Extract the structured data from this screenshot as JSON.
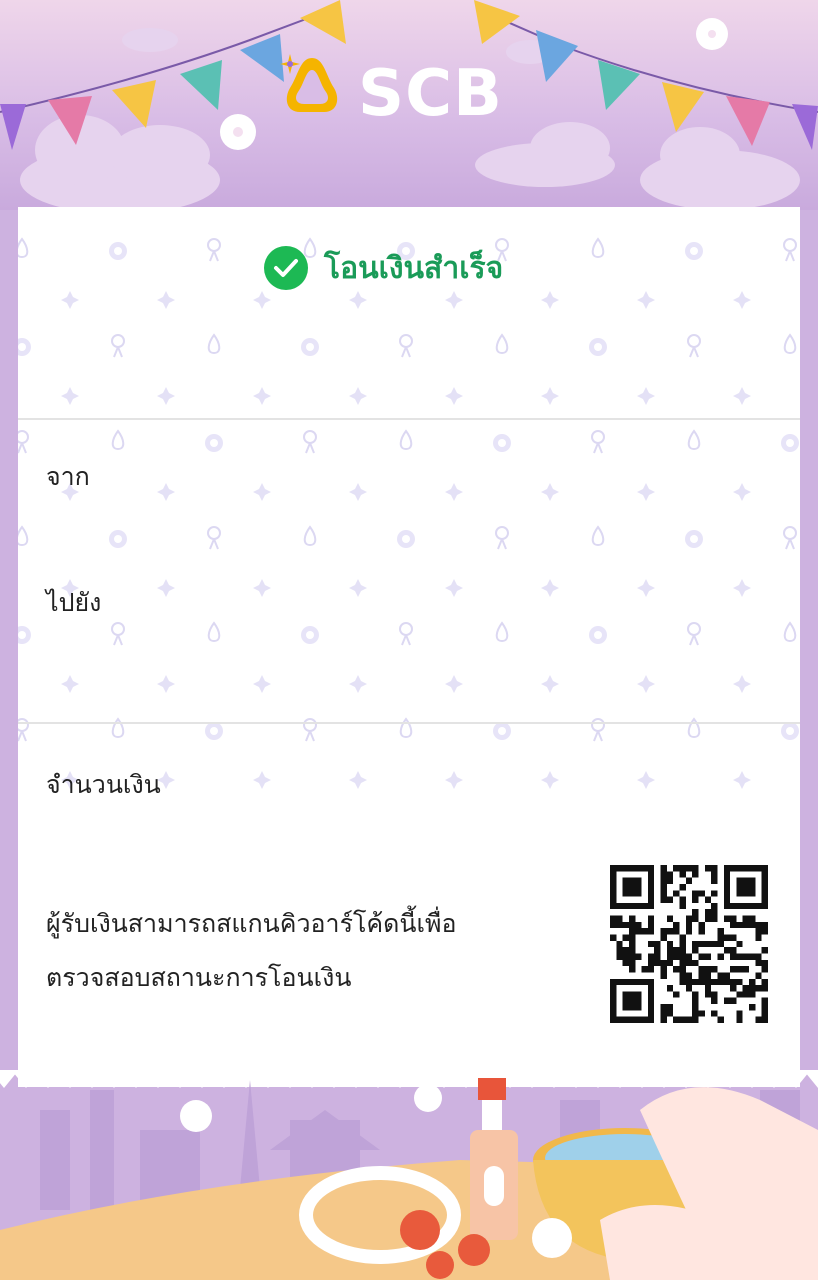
{
  "brand": {
    "name": "SCB"
  },
  "status": {
    "text": "โอนเงินสำเร็จ",
    "color": "#1db954"
  },
  "fields": {
    "from_label": "จาก",
    "to_label": "ไปยัง",
    "amount_label": "จำนวนเงิน"
  },
  "qr_note": {
    "line1": "ผู้รับเงินสามารถสแกนคิวอาร์โค้ดนี้เพื่อ",
    "line2": "ตรวจสอบสถานะการโอนเงิน"
  },
  "colors": {
    "accent": "#1a9b58",
    "background": "#cdb2e0",
    "logo": "#f5b400"
  },
  "icons": [
    "scb-logo-icon",
    "check-circle-icon",
    "qr-code-icon"
  ]
}
